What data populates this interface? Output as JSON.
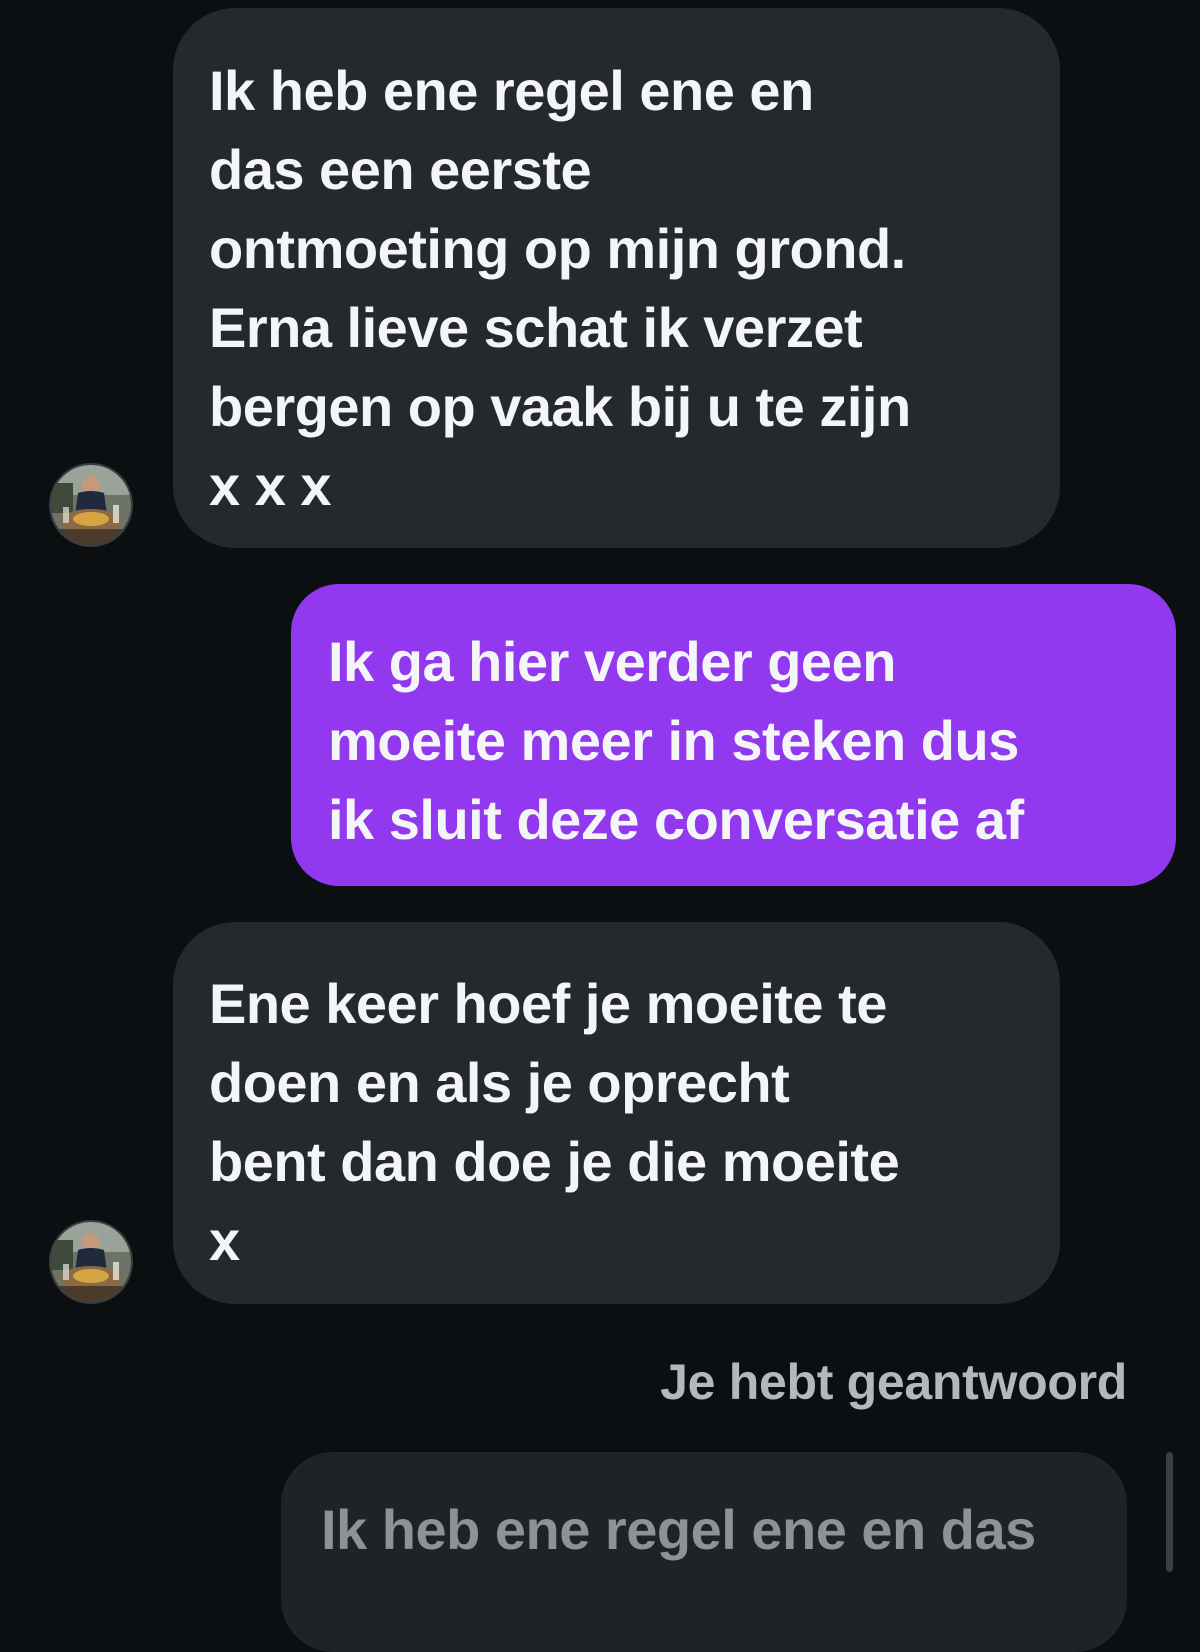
{
  "messages": [
    {
      "id": "incoming-1",
      "direction": "incoming",
      "text": "Ik heb ene regel ene en\ndas een eerste\nontmoeting op mijn grond.\nErna lieve schat ik verzet\nbergen op vaak bij u te zijn\nx x x"
    },
    {
      "id": "outgoing-1",
      "direction": "outgoing",
      "text": "Ik ga hier verder geen\nmoeite meer in steken dus\nik sluit deze conversatie af"
    },
    {
      "id": "incoming-2",
      "direction": "incoming",
      "text": "Ene keer hoef je moeite te\ndoen en als je oprecht\nbent dan doe je die moeite\nx"
    }
  ],
  "reply": {
    "label": "Je hebt geantwoord",
    "quoted_text": "Ik heb ene regel ene en das"
  },
  "colors": {
    "background": "#0c0f12",
    "incoming_bubble": "#25282d",
    "outgoing_bubble": "#9238ef",
    "quoted_bubble": "#1f2226"
  },
  "icons": {
    "avatar": "contact-photo"
  }
}
